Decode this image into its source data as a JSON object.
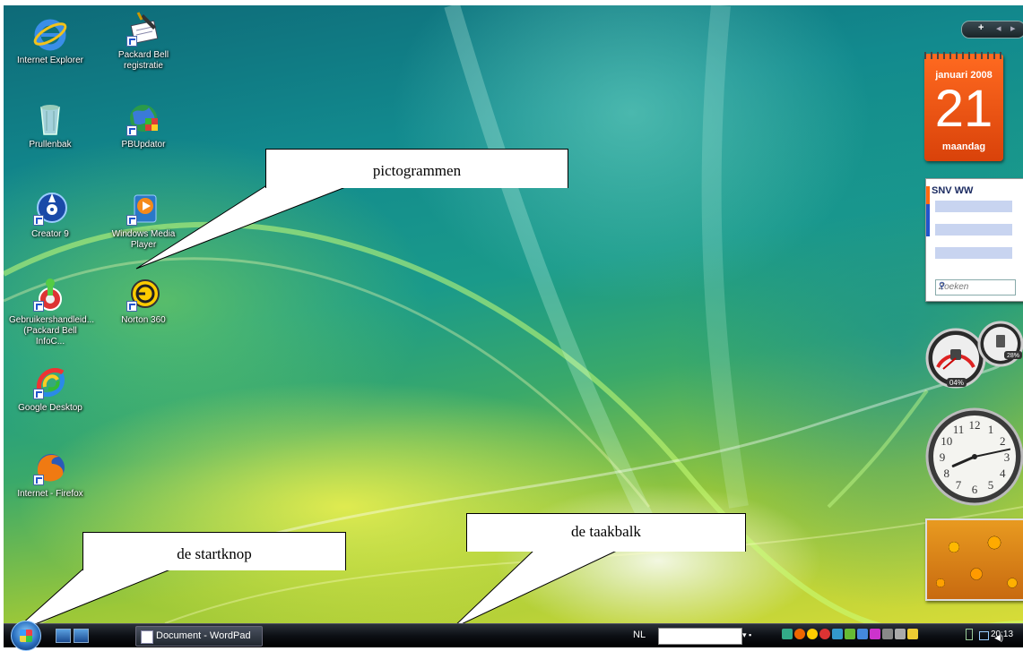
{
  "desktop": {
    "icons": [
      {
        "label": "Internet Explorer"
      },
      {
        "label": "Packard Bell\nregistratie"
      },
      {
        "label": "Prullenbak"
      },
      {
        "label": "PBUpdator"
      },
      {
        "label": "Creator 9"
      },
      {
        "label": "Windows Media\nPlayer"
      },
      {
        "label": "Gebruikershandleid...\n(Packard Bell InfoC..."
      },
      {
        "label": "Norton 360"
      },
      {
        "label": "Google Desktop"
      },
      {
        "label": "Internet - Firefox"
      }
    ]
  },
  "sidebar": {
    "controls": {
      "add": "+",
      "prev": "◂",
      "next": "▸"
    },
    "calendar": {
      "month": "januari 2008",
      "day": "21",
      "weekday": "maandag"
    },
    "notes": {
      "title": "SNV WW",
      "search_placeholder": "Zoeken"
    },
    "cpu_meter": {
      "cpu_percent": "04%",
      "memory_percent": "28%"
    },
    "clock": {
      "hour": 8,
      "minute": 13
    }
  },
  "callouts": {
    "icons": "pictogrammen",
    "start": "de startknop",
    "taskbar": "de taakbalk"
  },
  "taskbar": {
    "window_button": "Document - WordPad",
    "language": "NL",
    "time": "20:13"
  },
  "colors": {
    "calendar": "#e8500e",
    "taskbar": "#0c0f14"
  }
}
